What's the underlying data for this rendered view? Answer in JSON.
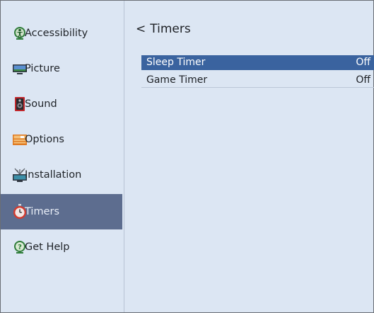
{
  "sidebar": {
    "items": [
      {
        "label": "Accessibility",
        "icon": "accessibility-icon"
      },
      {
        "label": "Picture",
        "icon": "picture-icon"
      },
      {
        "label": "Sound",
        "icon": "sound-icon"
      },
      {
        "label": "Options",
        "icon": "options-icon"
      },
      {
        "label": "Installation",
        "icon": "installation-icon"
      },
      {
        "label": "Timers",
        "icon": "timers-icon",
        "selected": true
      },
      {
        "label": "Get Help",
        "icon": "help-icon"
      }
    ]
  },
  "main": {
    "back_glyph": "<",
    "title": "Timers",
    "rows": [
      {
        "name": "Sleep Timer",
        "value": "Off",
        "selected": true
      },
      {
        "name": "Game Timer",
        "value": "Off"
      }
    ]
  },
  "colors": {
    "background": "#dce6f3",
    "sidebar_selected": "#5d6d8f",
    "row_selected": "#3a639f"
  }
}
